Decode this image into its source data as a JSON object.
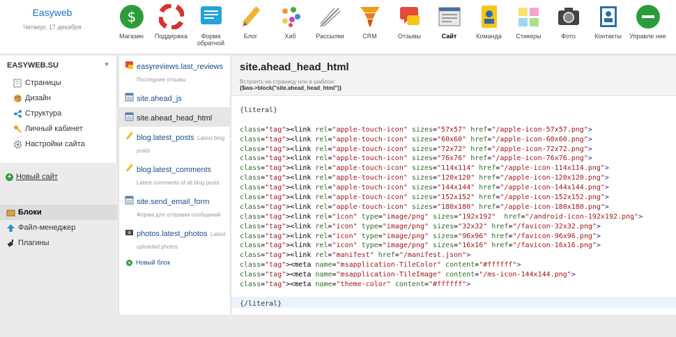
{
  "brand": {
    "name": "Easyweb",
    "date": "Четверг, 17 декабря"
  },
  "apps": [
    {
      "icon": "shop-icon",
      "label": "Магазин"
    },
    {
      "icon": "support-icon",
      "label": "Поддержка"
    },
    {
      "icon": "form-icon",
      "label": "Форма обратной"
    },
    {
      "icon": "blog-icon",
      "label": "Блог"
    },
    {
      "icon": "hub-icon",
      "label": "Хаб"
    },
    {
      "icon": "mailer-icon",
      "label": "Рассылки"
    },
    {
      "icon": "crm-icon",
      "label": "CRM"
    },
    {
      "icon": "reviews-icon",
      "label": "Отзывы"
    },
    {
      "icon": "site-icon",
      "label": "Сайт",
      "active": true
    },
    {
      "icon": "team-icon",
      "label": "Команда"
    },
    {
      "icon": "stickers-icon",
      "label": "Стикеры"
    },
    {
      "icon": "photo-icon",
      "label": "Фото"
    },
    {
      "icon": "contacts-icon",
      "label": "Контакты"
    },
    {
      "icon": "manage-icon",
      "label": "Управле ние"
    }
  ],
  "sidebar": {
    "account": "EASYWEB.SU",
    "items": [
      {
        "icon": "pages-icon",
        "label": "Страницы"
      },
      {
        "icon": "design-icon",
        "label": "Дизайн"
      },
      {
        "icon": "structure-icon",
        "label": "Структура"
      },
      {
        "icon": "key-icon",
        "label": "Личный кабинет"
      },
      {
        "icon": "settings-icon",
        "label": "Настройки сайта"
      }
    ],
    "new_site": "Новый сайт",
    "bottom": [
      {
        "icon": "blocks-icon",
        "label": "Блоки",
        "active": true
      },
      {
        "icon": "upload-icon",
        "label": "Файл-менеджер"
      },
      {
        "icon": "plugin-icon",
        "label": "Плагины"
      }
    ]
  },
  "blocks": [
    {
      "name": "easyreviews.last_reviews",
      "desc": "Последние отзывы"
    },
    {
      "name": "site.ahead_js",
      "desc": ""
    },
    {
      "name": "site.ahead_head_html",
      "desc": "",
      "selected": true
    },
    {
      "name": "blog.latest_posts",
      "desc": "Latest blog posts"
    },
    {
      "name": "blog.latest_comments",
      "desc": "Latest comments of all blog posts"
    },
    {
      "name": "site.send_email_form",
      "desc": "Форма для отправки сообщений"
    },
    {
      "name": "photos.latest_photos",
      "desc": "Latest uploaded photos"
    }
  ],
  "new_block": "Новый блок",
  "editor": {
    "title": "site.ahead_head_html",
    "hint": "Встроить на страницу или в шаблон:",
    "snippet": "{$wa->block(\"site.ahead_head_html\")}",
    "lines": [
      "{literal}",
      "",
      "<link rel=\"apple-touch-icon\" sizes=\"57x57\" href=\"/apple-icon-57x57.png\">",
      "<link rel=\"apple-touch-icon\" sizes=\"60x60\" href=\"/apple-icon-60x60.png\">",
      "<link rel=\"apple-touch-icon\" sizes=\"72x72\" href=\"/apple-icon-72x72.png\">",
      "<link rel=\"apple-touch-icon\" sizes=\"76x76\" href=\"/apple-icon-76x76.png\">",
      "<link rel=\"apple-touch-icon\" sizes=\"114x114\" href=\"/apple-icon-114x114.png\">",
      "<link rel=\"apple-touch-icon\" sizes=\"120x120\" href=\"/apple-icon-120x120.png\">",
      "<link rel=\"apple-touch-icon\" sizes=\"144x144\" href=\"/apple-icon-144x144.png\">",
      "<link rel=\"apple-touch-icon\" sizes=\"152x152\" href=\"/apple-icon-152x152.png\">",
      "<link rel=\"apple-touch-icon\" sizes=\"180x180\" href=\"/apple-icon-180x180.png\">",
      "<link rel=\"icon\" type=\"image/png\" sizes=\"192x192\"  href=\"/android-icon-192x192.png\">",
      "<link rel=\"icon\" type=\"image/png\" sizes=\"32x32\" href=\"/favicon-32x32.png\">",
      "<link rel=\"icon\" type=\"image/png\" sizes=\"96x96\" href=\"/favicon-96x96.png\">",
      "<link rel=\"icon\" type=\"image/png\" sizes=\"16x16\" href=\"/favicon-16x16.png\">",
      "<link rel=\"manifest\" href=\"/manifest.json\">",
      "<meta name=\"msapplication-TileColor\" content=\"#ffffff\">",
      "<meta name=\"msapplication-TileImage\" content=\"/ms-icon-144x144.png\">",
      "<meta name=\"theme-color\" content=\"#ffffff\">",
      "",
      "{/literal}"
    ]
  }
}
